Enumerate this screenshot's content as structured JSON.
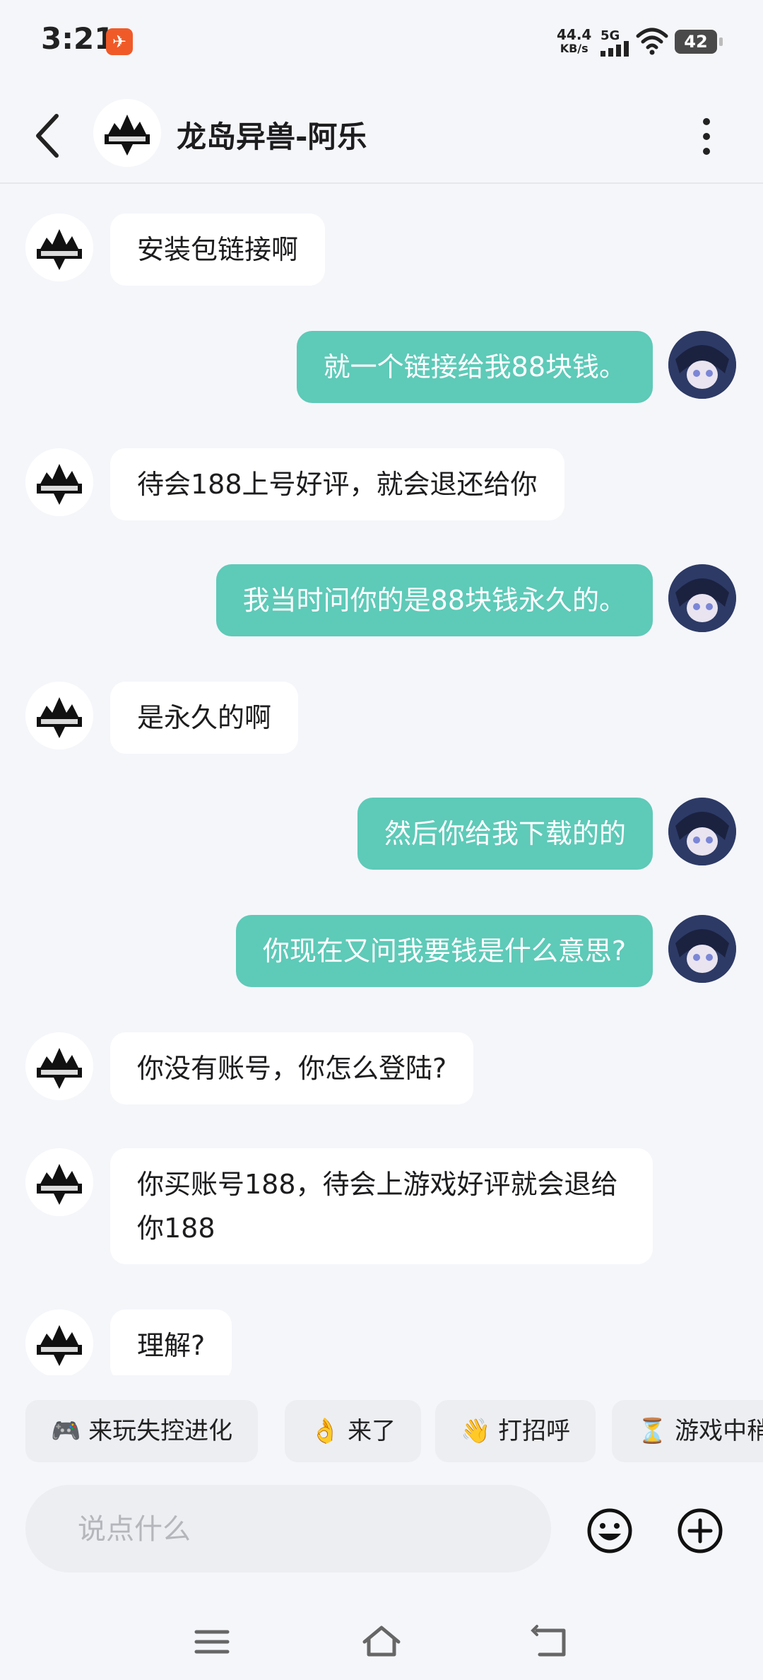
{
  "status_bar": {
    "time": "3:21",
    "net_speed_value": "44.4",
    "net_speed_unit": "KB/s",
    "network_type": "5G",
    "battery": "42"
  },
  "header": {
    "title": "龙岛异兽-阿乐"
  },
  "messages": [
    {
      "from": "other",
      "text": "安装包链接啊"
    },
    {
      "from": "me",
      "text": "就一个链接给我88块钱。"
    },
    {
      "from": "other",
      "text": "待会188上号好评，就会退还给你"
    },
    {
      "from": "me",
      "text": "我当时问你的是88块钱永久的。"
    },
    {
      "from": "other",
      "text": "是永久的啊"
    },
    {
      "from": "me",
      "text": "然后你给我下载的的"
    },
    {
      "from": "me",
      "text": "你现在又问我要钱是什么意思?"
    },
    {
      "from": "other",
      "text": "你没有账号，你怎么登陆?"
    },
    {
      "from": "other",
      "text": "你买账号188，待会上游戏好评就会退给你188"
    },
    {
      "from": "other",
      "text": "理解?"
    }
  ],
  "quick_replies": [
    {
      "icon": "🎮",
      "label": "来玩失控进化"
    },
    {
      "icon": "👌",
      "label": "来了"
    },
    {
      "icon": "👋",
      "label": "打招呼"
    },
    {
      "icon": "⏳",
      "label": "游戏中稍"
    }
  ],
  "input": {
    "placeholder": "说点什么"
  },
  "colors": {
    "my_bubble": "#5ecab8",
    "other_bubble": "#ffffff",
    "background": "#f5f6fa"
  }
}
